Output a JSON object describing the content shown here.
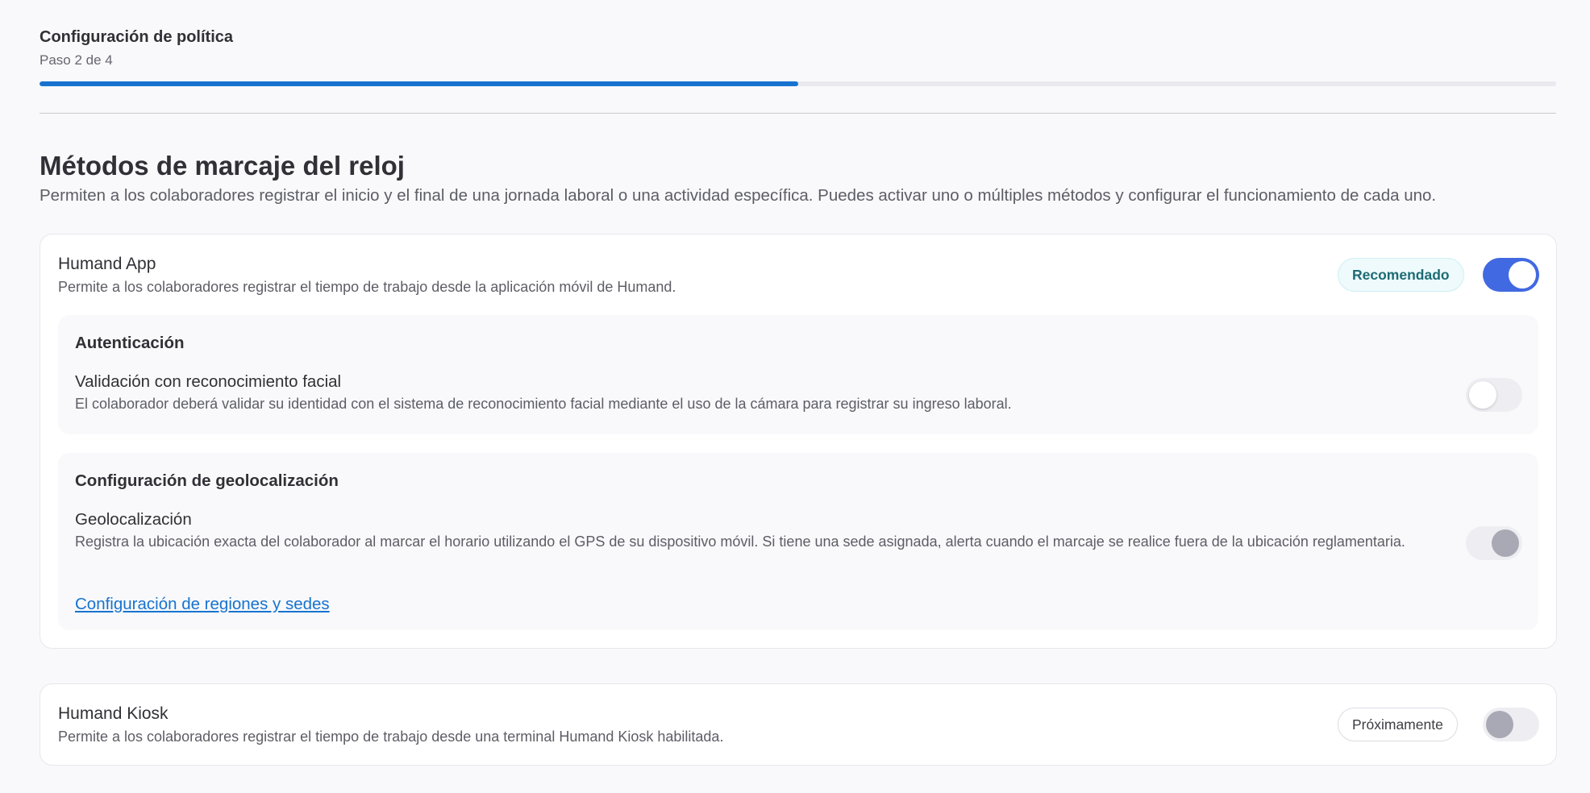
{
  "header": {
    "title": "Configuración de política",
    "step": "Paso 2 de 4",
    "progress_fraction": 0.5
  },
  "section": {
    "title": "Métodos de marcaje del reloj",
    "description": "Permiten a los colaboradores registrar el inicio y el final de una jornada laboral o una actividad específica. Puedes activar uno o múltiples métodos y configurar el funcionamiento de cada uno."
  },
  "humand_app": {
    "title": "Humand App",
    "description": "Permite a los colaboradores registrar el tiempo de trabajo desde la aplicación móvil de Humand.",
    "badge": "Recomendado",
    "enabled": true,
    "auth": {
      "title": "Autenticación",
      "option_title": "Validación con reconocimiento facial",
      "option_desc": "El colaborador deberá validar su identidad con el sistema de reconocimiento facial mediante el uso de la cámara para registrar su ingreso laboral.",
      "enabled": false
    },
    "geo": {
      "title": "Configuración de geolocalización",
      "option_title": "Geolocalización",
      "option_desc": "Registra la ubicación exacta del colaborador al marcar el horario utilizando el GPS de su dispositivo móvil. Si tiene una sede asignada, alerta cuando el marcaje se realice fuera de la ubicación reglamentaria.",
      "enabled": true,
      "disabled": true,
      "link": "Configuración de regiones y sedes"
    }
  },
  "humand_kiosk": {
    "title": "Humand Kiosk",
    "description": "Permite a los colaboradores registrar el tiempo de trabajo desde una terminal Humand Kiosk habilitada.",
    "badge": "Próximamente",
    "enabled": false,
    "disabled": true
  },
  "colors": {
    "accent": "#1773cf",
    "toggle_on": "#4169e1",
    "badge_rec_text": "#1d6b73"
  }
}
